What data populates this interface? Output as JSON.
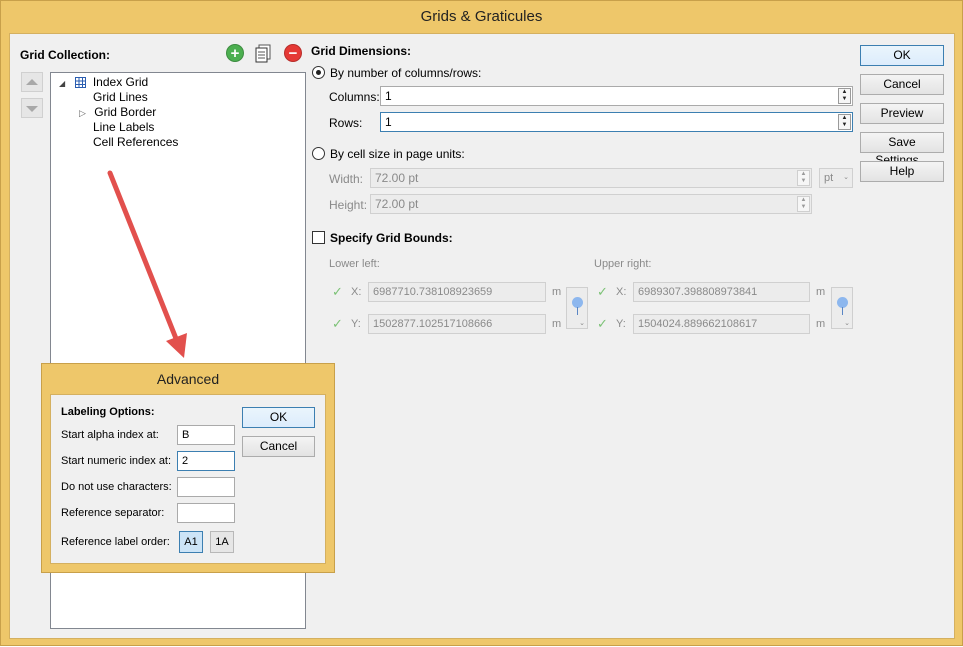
{
  "window": {
    "title": "Grids & Graticules"
  },
  "grid_collection": {
    "label": "Grid Collection:",
    "tree": [
      {
        "label": "Index Grid",
        "level": 0,
        "expander": "◢",
        "icon": "grid-icon"
      },
      {
        "label": "Grid Lines",
        "level": 1,
        "expander": ""
      },
      {
        "label": "Grid Border",
        "level": 1,
        "expander": "▷"
      },
      {
        "label": "Line Labels",
        "level": 1,
        "expander": ""
      },
      {
        "label": "Cell References",
        "level": 1,
        "expander": ""
      }
    ]
  },
  "toolbar": {
    "add_icon": "plus-icon",
    "copy_icon": "document-copy-icon",
    "remove_icon": "minus-icon",
    "add_glyph": "+",
    "remove_glyph": "−"
  },
  "grid_dimensions": {
    "title": "Grid Dimensions:",
    "by_columns_rows_label": "By number of columns/rows:",
    "columns_label": "Columns:",
    "columns_value": "1",
    "rows_label": "Rows:",
    "rows_value": "1",
    "by_cell_size_label": "By cell size in page units:",
    "width_label": "Width:",
    "width_value": "72.00 pt",
    "height_label": "Height:",
    "height_value": "72.00 pt",
    "unit_value": "pt",
    "selected_mode": "columns_rows"
  },
  "grid_bounds": {
    "label": "Specify Grid Bounds:",
    "checked": false,
    "lower_left_label": "Lower left:",
    "upper_right_label": "Upper right:",
    "x_label": "X:",
    "y_label": "Y:",
    "unit": "m",
    "lower_left_x": "6987710.738108923659",
    "lower_left_y": "1502877.102517108666",
    "upper_right_x": "6989307.398808973841",
    "upper_right_y": "1504024.889662108617"
  },
  "buttons": {
    "ok": "OK",
    "cancel": "Cancel",
    "preview": "Preview",
    "save_settings": "Save Settings...",
    "help": "Help"
  },
  "advanced": {
    "title": "Advanced",
    "section_label": "Labeling Options:",
    "start_alpha_label": "Start alpha index at:",
    "start_alpha_value": "B",
    "start_numeric_label": "Start numeric index at:",
    "start_numeric_value": "2",
    "do_not_use_label": "Do not use characters:",
    "do_not_use_value": "",
    "separator_label": "Reference separator:",
    "separator_value": "",
    "order_label": "Reference label order:",
    "order_a1": "A1",
    "order_1a": "1A",
    "selected_order": "A1",
    "ok": "OK",
    "cancel": "Cancel"
  },
  "colors": {
    "title_bar": "#eec76a",
    "arrow": "#e2504d",
    "add_green": "#4caf50",
    "remove_red": "#e53935"
  }
}
